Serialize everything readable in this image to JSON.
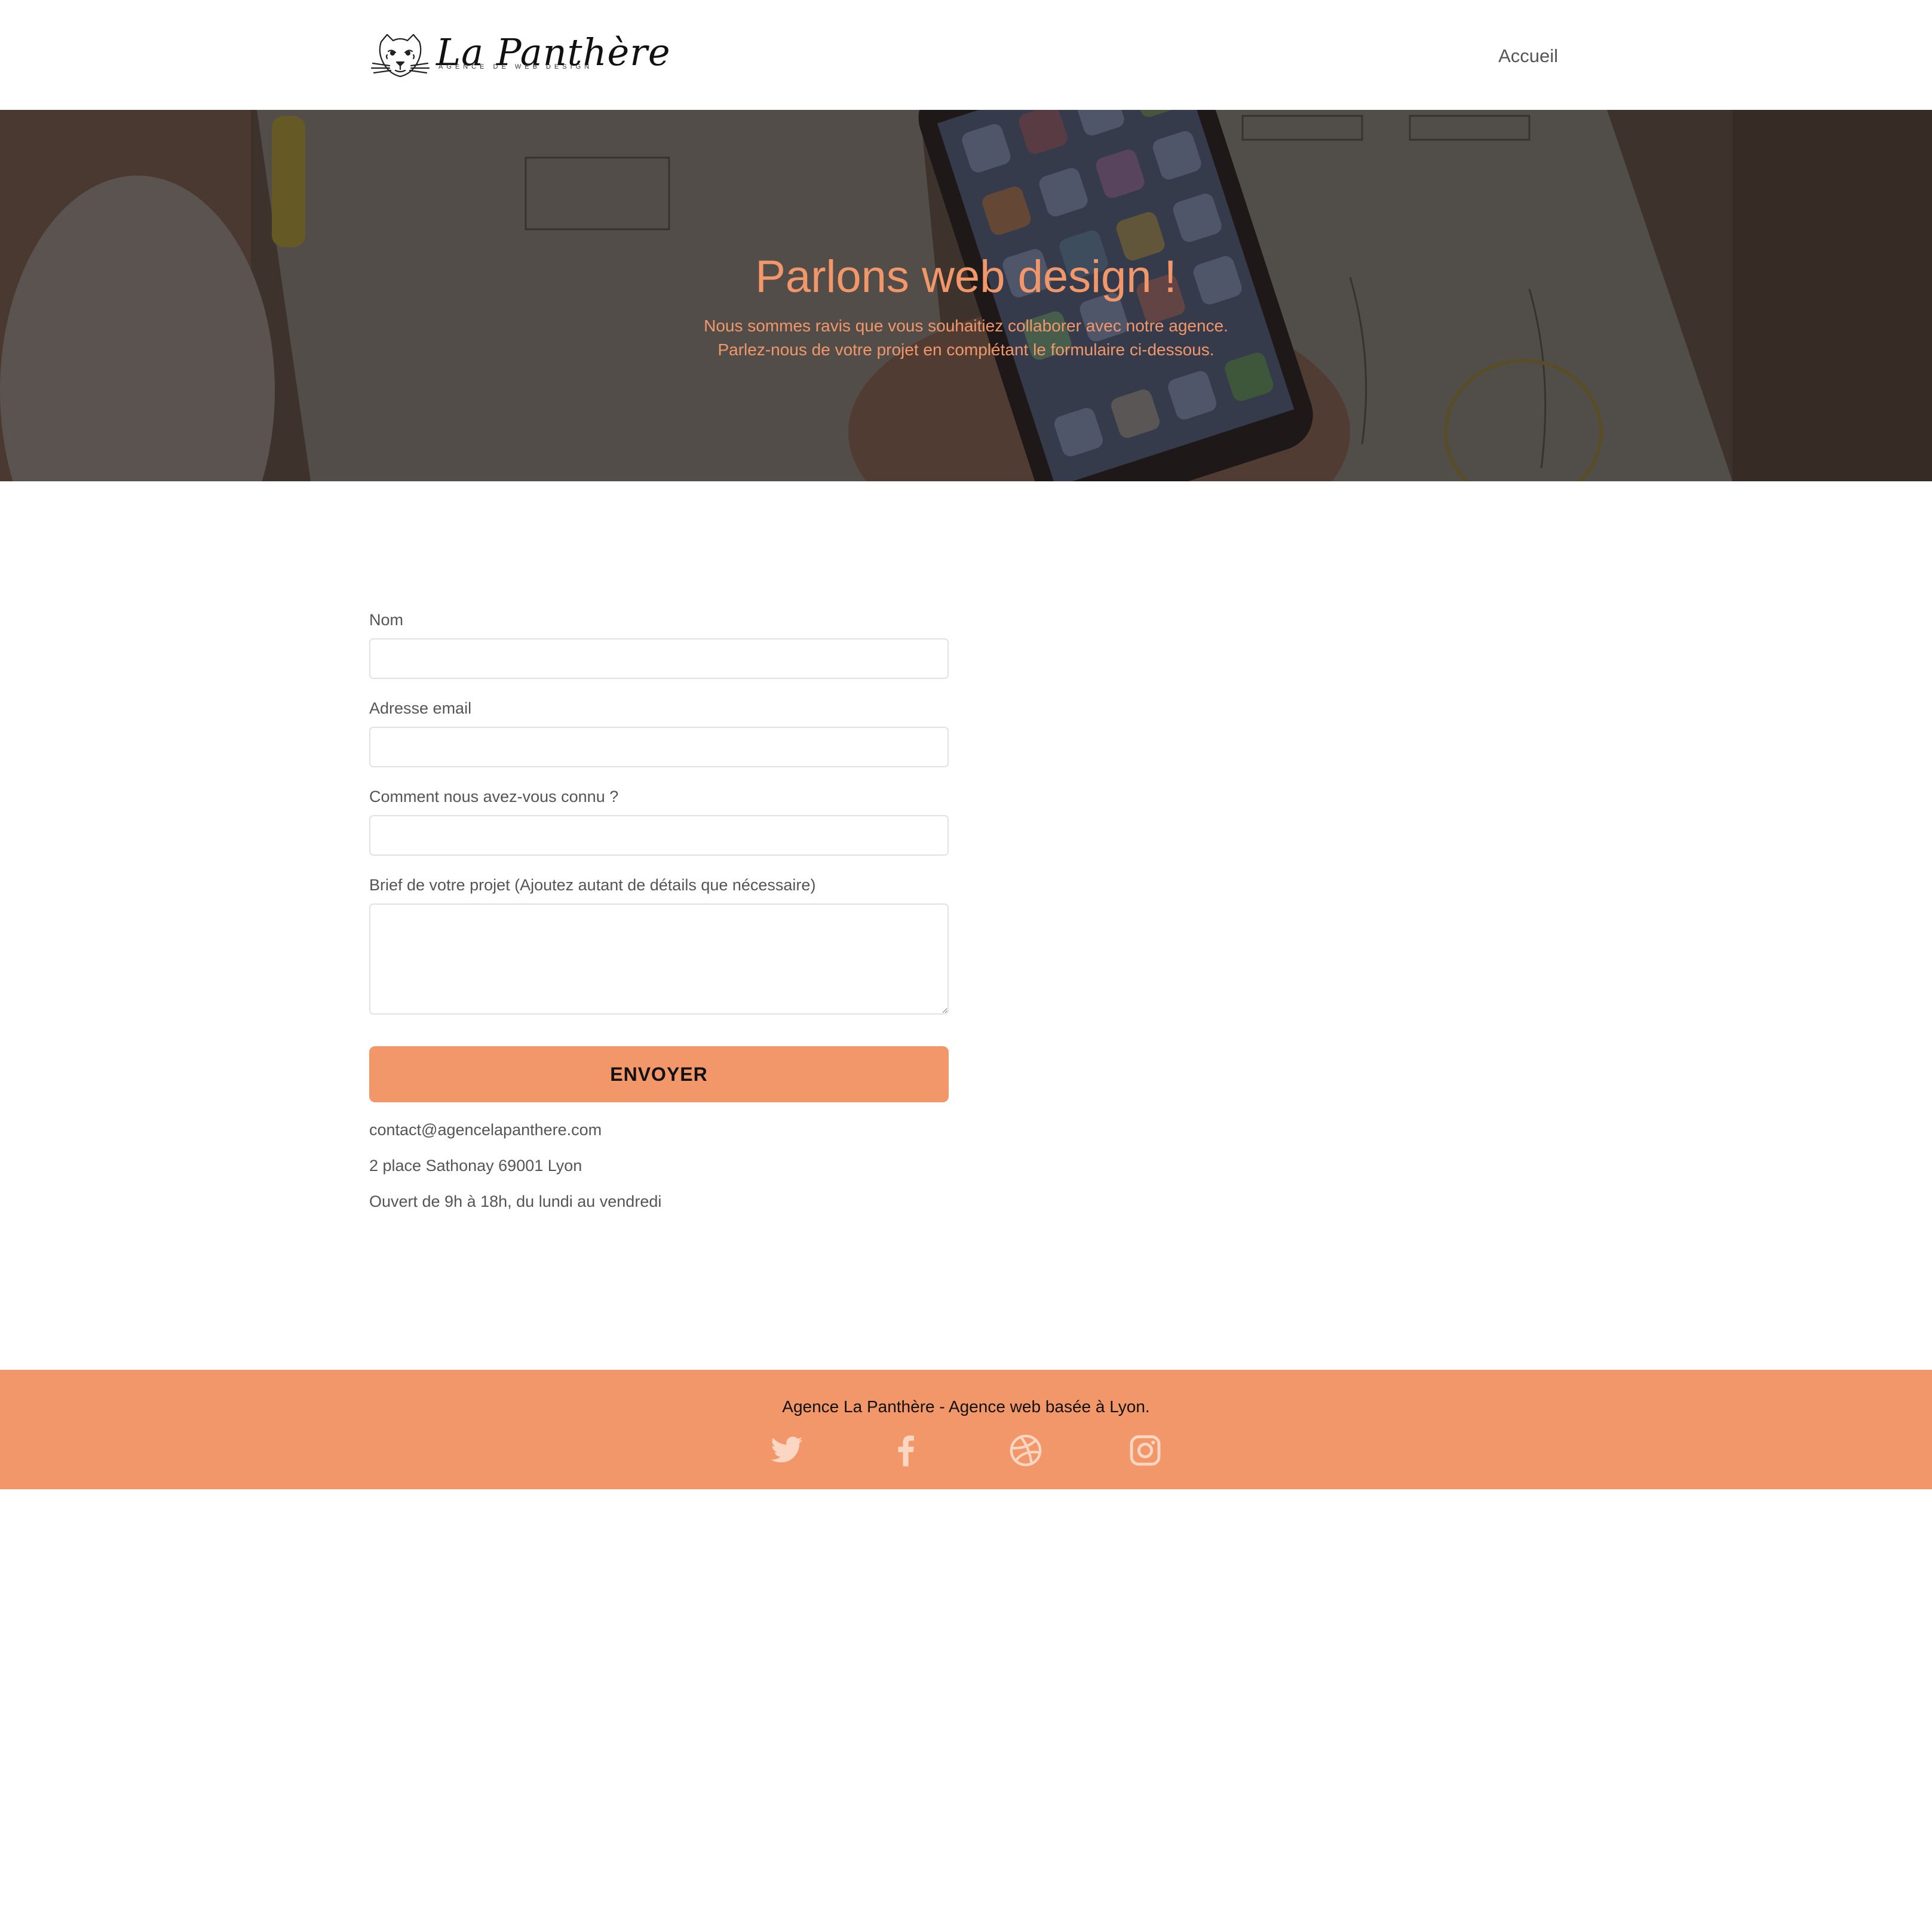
{
  "header": {
    "logo": {
      "name": "La Panthère",
      "tagline": "AGENCE DE WEB DESIGN",
      "icon": "panther-head-icon"
    },
    "nav": {
      "home_label": "Accueil"
    }
  },
  "hero": {
    "title": "Parlons web design !",
    "subtitle_line1": "Nous sommes ravis que vous souhaitiez collaborer avec notre agence.",
    "subtitle_line2": "Parlez-nous de votre projet en complétant le formulaire ci-dessous.",
    "background": "desk-with-phone-and-sketches-photo"
  },
  "form": {
    "fields": [
      {
        "label": "Nom",
        "value": "",
        "placeholder": ""
      },
      {
        "label": "Adresse email",
        "value": "",
        "placeholder": ""
      },
      {
        "label": "Comment nous avez-vous connu ?",
        "value": "",
        "placeholder": ""
      },
      {
        "label": "Brief de votre projet (Ajoutez autant de détails que nécessaire)",
        "value": "",
        "placeholder": ""
      }
    ],
    "submit_label": "ENVOYER"
  },
  "contact": {
    "email": "contact@agencelapanthere.com",
    "address": "2 place Sathonay 69001 Lyon",
    "hours": "Ouvert de 9h à 18h, du lundi au vendredi"
  },
  "footer": {
    "text": "Agence La Panthère - Agence web basée à Lyon.",
    "social": [
      {
        "name": "Twitter",
        "icon": "twitter-icon"
      },
      {
        "name": "Facebook",
        "icon": "facebook-icon"
      },
      {
        "name": "Dribbble",
        "icon": "dribbble-icon"
      },
      {
        "name": "Instagram",
        "icon": "instagram-icon"
      }
    ]
  },
  "colors": {
    "accent": "#f2976a",
    "text": "#555555",
    "input_border": "#e2e2e2",
    "footer_text": "#111111"
  }
}
